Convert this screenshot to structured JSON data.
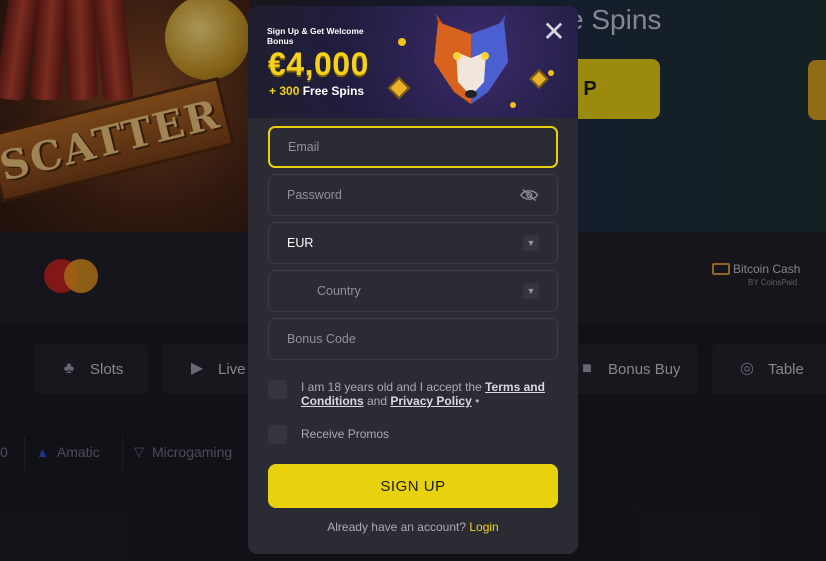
{
  "hero": {
    "scatter_text": "SCATTER",
    "title_fragment": "e Spins",
    "cta_fragment": "P"
  },
  "payments": {
    "bitcoin_name": "Bitcoin Cash",
    "bitcoin_by": "BY CoinsPaid"
  },
  "categories": [
    {
      "label": "Slots",
      "icon": "cherries-icon"
    },
    {
      "label": "Live",
      "icon": "play-icon"
    },
    {
      "label": "Bonus Buy",
      "icon": "gift-icon"
    },
    {
      "label": "Table",
      "icon": "roulette-icon"
    }
  ],
  "providers": [
    {
      "label": "0"
    },
    {
      "label": "Amatic"
    },
    {
      "label": "Microgaming"
    }
  ],
  "modal": {
    "promo": {
      "headline": "Sign Up & Get Welcome Bonus",
      "amount": "€4,000",
      "spins_plus": "+ 300",
      "spins_label": "Free Spins"
    },
    "close_label": "✕",
    "email_placeholder": "Email",
    "password_placeholder": "Password",
    "currency_value": "EUR",
    "country_placeholder": "Country",
    "bonus_code_placeholder": "Bonus Code",
    "terms_prefix": "I am 18 years old and I accept the ",
    "terms_link": "Terms and Conditions",
    "terms_and": " and ",
    "privacy_link": "Privacy Policy",
    "terms_suffix": " •",
    "promos_label": "Receive Promos",
    "signup_label": "SIGN UP",
    "login_prompt": "Already have an account? ",
    "login_link": "Login"
  },
  "colors": {
    "accent": "#e8d20d",
    "modal_bg": "#2a2b33",
    "page_bg": "#16171c"
  }
}
